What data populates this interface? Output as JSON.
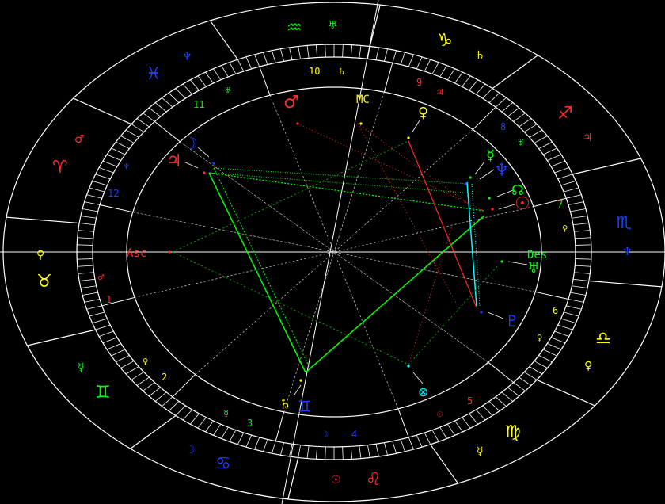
{
  "colors": {
    "background": "#000000",
    "wheel": "#ffffff",
    "fire": "#ff2a2a",
    "earth": "#ffff00",
    "air": "#00ff00",
    "water": "#1e3cff",
    "house_numbers_a": "#ffff00",
    "house_numbers_b": "#ff2a2a",
    "house_numbers_c": "#00ff00",
    "house_numbers_d": "#1e3cff",
    "aspect_trine": "#00ff00",
    "aspect_square": "#ff2a2a",
    "aspect_opposition": "#00ffff",
    "aspect_minor": "#00aa00"
  },
  "signs": [
    {
      "name": "aquarius",
      "glyph": "♒",
      "color": "#00ff00",
      "ruler": "♅",
      "ruler_color": "#00ff00"
    },
    {
      "name": "capricorn",
      "glyph": "♑",
      "color": "#ffff00",
      "ruler": "♄",
      "ruler_color": "#ffff00"
    },
    {
      "name": "sagittarius",
      "glyph": "♐",
      "color": "#ff2a2a",
      "ruler": "♃",
      "ruler_color": "#ff2a2a"
    },
    {
      "name": "scorpio",
      "glyph": "♏",
      "color": "#1e3cff",
      "ruler": "♆",
      "ruler_color": "#1e3cff"
    },
    {
      "name": "libra",
      "glyph": "♎",
      "color": "#ffff00",
      "ruler": "♀",
      "ruler_color": "#ffff00"
    },
    {
      "name": "virgo",
      "glyph": "♍",
      "color": "#ffff00",
      "ruler": "☿",
      "ruler_color": "#ffff00"
    },
    {
      "name": "leo",
      "glyph": "♌",
      "color": "#ff2a2a",
      "ruler": "☉",
      "ruler_color": "#ff2a2a"
    },
    {
      "name": "cancer",
      "glyph": "♋",
      "color": "#1e3cff",
      "ruler": "☽",
      "ruler_color": "#1e3cff"
    },
    {
      "name": "gemini",
      "glyph": "♊",
      "color": "#00ff00",
      "ruler": "☿",
      "ruler_color": "#00ff00"
    },
    {
      "name": "taurus",
      "glyph": "♉",
      "color": "#ffff00",
      "ruler": "♀",
      "ruler_color": "#ffff00"
    },
    {
      "name": "aries",
      "glyph": "♈",
      "color": "#ff2a2a",
      "ruler": "♂",
      "ruler_color": "#ff2a2a"
    },
    {
      "name": "pisces",
      "glyph": "♓",
      "color": "#1e3cff",
      "ruler": "♆",
      "ruler_color": "#1e3cff"
    }
  ],
  "houses": [
    {
      "number": "10",
      "color": "#ffff00",
      "ruler": "♄",
      "ruler_color": "#ffff00"
    },
    {
      "number": "9",
      "color": "#ff2a2a",
      "ruler": "♃",
      "ruler_color": "#ff2a2a"
    },
    {
      "number": "8",
      "color": "#1e3cff",
      "ruler": "♅",
      "ruler_color": "#00ff00"
    },
    {
      "number": "7",
      "color": "#00ff00",
      "ruler": "♀",
      "ruler_color": "#ffff00"
    },
    {
      "number": "6",
      "color": "#ffff00",
      "ruler": "♀",
      "ruler_color": "#ffff00"
    },
    {
      "number": "5",
      "color": "#ff2a2a",
      "ruler": "☉",
      "ruler_color": "#ff2a2a"
    },
    {
      "number": "4",
      "color": "#1e3cff",
      "ruler": "☽",
      "ruler_color": "#1e3cff"
    },
    {
      "number": "3",
      "color": "#00ff00",
      "ruler": "☿",
      "ruler_color": "#00ff00"
    },
    {
      "number": "2",
      "color": "#ffff00",
      "ruler": "♀",
      "ruler_color": "#ffff00"
    },
    {
      "number": "1",
      "color": "#ff2a2a",
      "ruler": "♂",
      "ruler_color": "#ff2a2a"
    },
    {
      "number": "12",
      "color": "#1e3cff",
      "ruler": "♆",
      "ruler_color": "#1e3cff"
    },
    {
      "number": "11",
      "color": "#00ff00",
      "ruler": "♅",
      "ruler_color": "#00ff00"
    }
  ],
  "angles": {
    "asc": {
      "label": "Asc",
      "color": "#ff2a2a"
    },
    "mc": {
      "label": "MC",
      "color": "#ffff00"
    },
    "des": {
      "label": "Des",
      "color": "#00ff00"
    }
  },
  "planets": [
    {
      "name": "mars",
      "glyph": "♂",
      "color": "#ff2a2a"
    },
    {
      "name": "mc",
      "glyph": "MC",
      "color": "#ffff00"
    },
    {
      "name": "venus",
      "glyph": "♀",
      "color": "#ffff00"
    },
    {
      "name": "moon",
      "glyph": "☽",
      "color": "#1e3cff"
    },
    {
      "name": "jupiter",
      "glyph": "♃",
      "color": "#ff2a2a"
    },
    {
      "name": "mercury",
      "glyph": "☿",
      "color": "#00ff00"
    },
    {
      "name": "neptune",
      "glyph": "♆",
      "color": "#1e3cff"
    },
    {
      "name": "node",
      "glyph": "☊",
      "color": "#00ff00"
    },
    {
      "name": "sun",
      "glyph": "☉",
      "color": "#ff2a2a"
    },
    {
      "name": "uranus",
      "glyph": "♅",
      "color": "#00ff00"
    },
    {
      "name": "pluto",
      "glyph": "♇",
      "color": "#1e3cff"
    },
    {
      "name": "fortune",
      "glyph": "⊗",
      "color": "#00ffff"
    },
    {
      "name": "saturn",
      "glyph": "♄",
      "color": "#ffff00"
    },
    {
      "name": "gemini-cusp",
      "glyph": "♊",
      "color": "#1e3cff"
    }
  ]
}
